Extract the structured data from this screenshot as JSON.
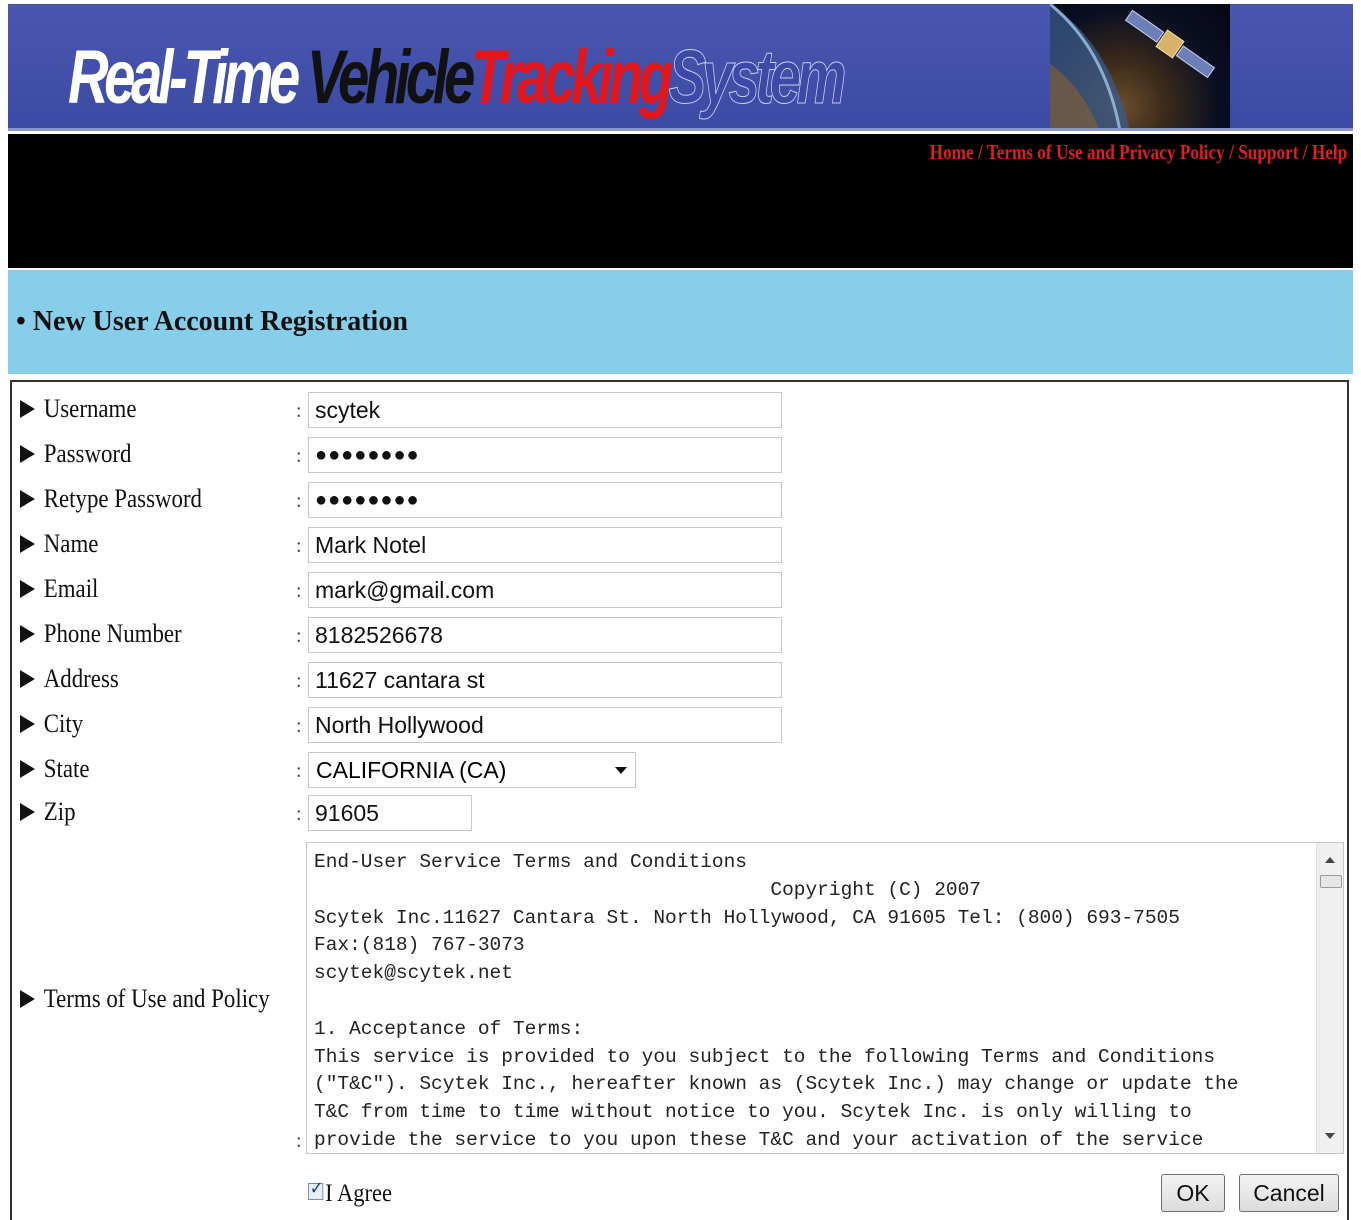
{
  "brand": {
    "title_words": [
      "Real-Time",
      "Vehicle",
      "Tracking",
      "System"
    ],
    "colors": {
      "banner": "#3b4aa4",
      "accent_red": "#e2161b",
      "header_band": "#87ceea",
      "black_bar": "#000000"
    }
  },
  "nav": {
    "items": [
      "Home",
      "Terms of Use and Privacy Policy",
      "Support",
      "Help"
    ],
    "separator": " / "
  },
  "page": {
    "title": "• New User Account Registration"
  },
  "form": {
    "fields": [
      {
        "label": "Username",
        "value": "scytek"
      },
      {
        "label": "Password",
        "value": "●●●●●●●●"
      },
      {
        "label": "Retype Password",
        "value": "●●●●●●●●"
      },
      {
        "label": "Name",
        "value": "Mark Notel"
      },
      {
        "label": "Email",
        "value": "mark@gmail.com"
      },
      {
        "label": "Phone Number",
        "value": "8182526678"
      },
      {
        "label": "Address",
        "value": "11627 cantara st"
      },
      {
        "label": "City",
        "value": "North Hollywood"
      },
      {
        "label": "State",
        "value": "CALIFORNIA (CA)"
      },
      {
        "label": "Zip",
        "value": "91605"
      }
    ],
    "colon": ":",
    "terms_label": "Terms of Use and Policy",
    "terms_text": "End-User Service Terms and Conditions\n                                       Copyright (C) 2007\nScytek Inc.11627 Cantara St. North Hollywood, CA 91605 Tel: (800) 693-7505\nFax:(818) 767-3073\nscytek@scytek.net\n\n1. Acceptance of Terms:\nThis service is provided to you subject to the following Terms and Conditions\n(\"T&C\"). Scytek Inc., hereafter known as (Scytek Inc.) may change or update the\nT&C from time to time without notice to you. Scytek Inc. is only willing to\nprovide the service to you upon these T&C and your activation of the service",
    "agree_label": "I Agree",
    "agree_checked": true,
    "ok_label": "OK",
    "cancel_label": "Cancel"
  }
}
